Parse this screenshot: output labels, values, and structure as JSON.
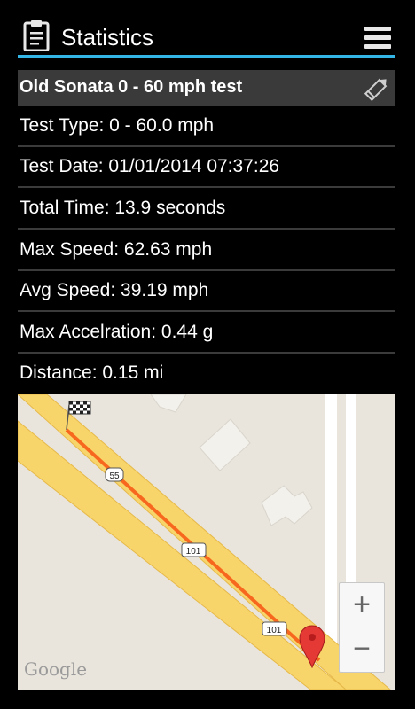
{
  "action_bar": {
    "title": "Statistics",
    "app_icon": "clipboard-icon",
    "menu_icon": "hamburger-menu-icon",
    "accent_color": "#33b5e5"
  },
  "run": {
    "title": "Old Sonata 0 - 60 mph test",
    "edit_icon": "pencil-icon"
  },
  "stats": [
    "Test Type: 0 - 60.0 mph",
    "Test Date: 01/01/2014 07:37:26",
    "Total Time: 13.9 seconds",
    "Max Speed: 62.63 mph",
    "Avg Speed: 39.19 mph",
    "Max Accelration: 0.44 g",
    "Distance: 0.15 mi"
  ],
  "map": {
    "route_shields": [
      "55",
      "101",
      "101"
    ],
    "zoom_in": "+",
    "zoom_out": "−",
    "attribution": "Google",
    "start_marker": "checkered-flag-icon",
    "end_marker": "map-pin-icon",
    "route_color": "#f7681e",
    "road_color": "#f8d56b"
  }
}
